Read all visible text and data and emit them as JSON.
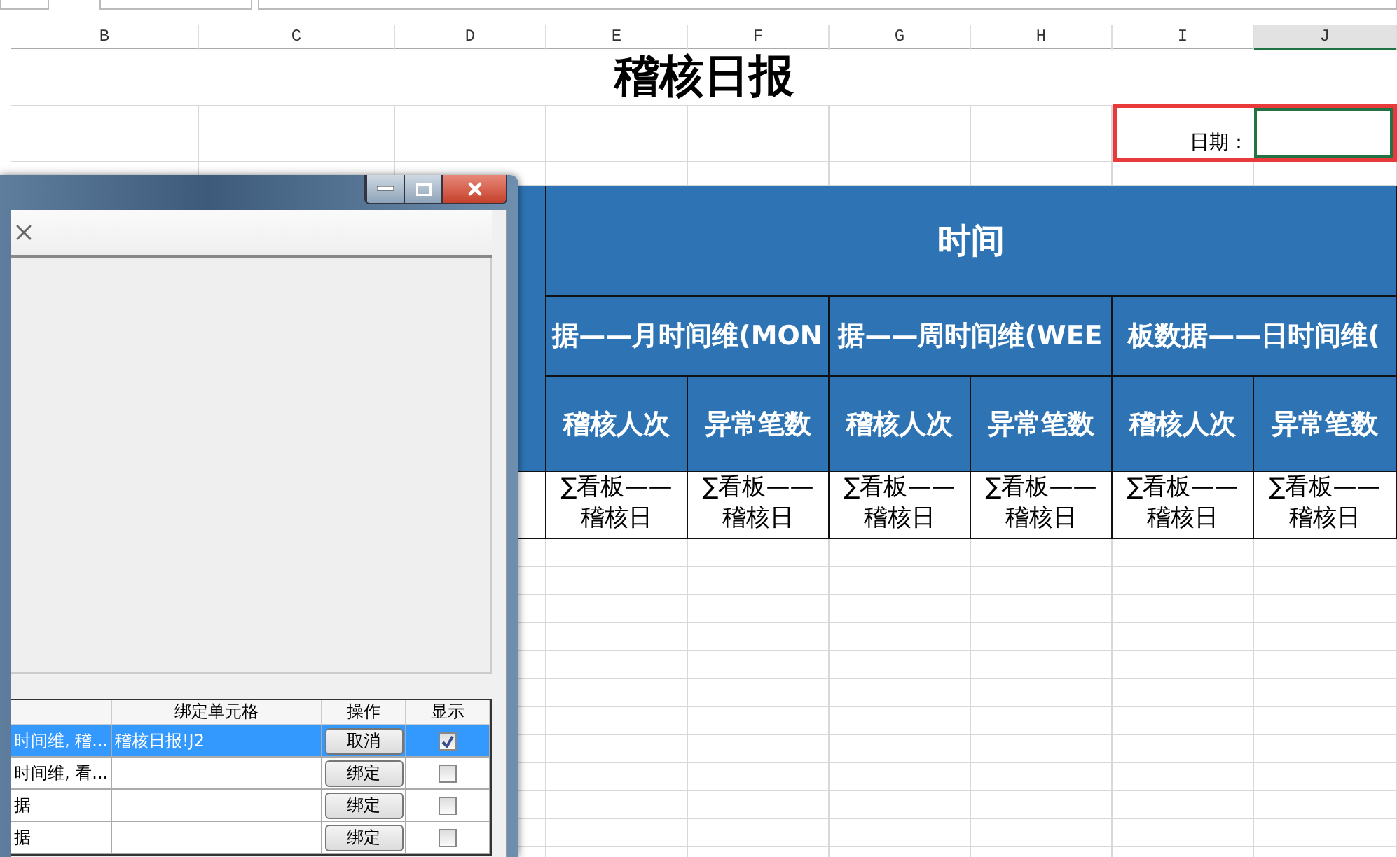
{
  "columns": [
    {
      "label": "B",
      "selected": false
    },
    {
      "label": "C",
      "selected": false
    },
    {
      "label": "D",
      "selected": false
    },
    {
      "label": "E",
      "selected": false
    },
    {
      "label": "F",
      "selected": false
    },
    {
      "label": "G",
      "selected": false
    },
    {
      "label": "H",
      "selected": false
    },
    {
      "label": "I",
      "selected": false
    },
    {
      "label": "J",
      "selected": true
    }
  ],
  "sheet": {
    "title": "稽核日报",
    "date_label": "日期：",
    "group_header": "时间",
    "subgroups": [
      "据——月时间维(MON",
      "据——周时间维(WEE",
      "板数据——日时间维("
    ],
    "metrics": [
      "稽核人次",
      "异常笔数",
      "稽核人次",
      "异常笔数",
      "稽核人次",
      "异常笔数"
    ],
    "formulas": [
      "∑看板——稽核日",
      "∑看板——稽核日",
      "∑看板——稽核日",
      "∑看板——稽核日",
      "∑看板——稽核日",
      "∑看板——稽核日"
    ]
  },
  "dialog": {
    "table": {
      "columns": [
        "绑定单元格",
        "操作",
        "显示"
      ],
      "rows": [
        {
          "dimension": "时间维, 稽...",
          "cell": "稽核日报!J2",
          "action": "取消",
          "shown": true,
          "selected": true
        },
        {
          "dimension": "时间维, 看...",
          "action": "绑定",
          "shown": false,
          "selected": false
        },
        {
          "dimension": "据",
          "action": "绑定",
          "shown": false,
          "selected": false
        },
        {
          "dimension": "据",
          "action": "绑定",
          "shown": false,
          "selected": false
        }
      ]
    }
  }
}
